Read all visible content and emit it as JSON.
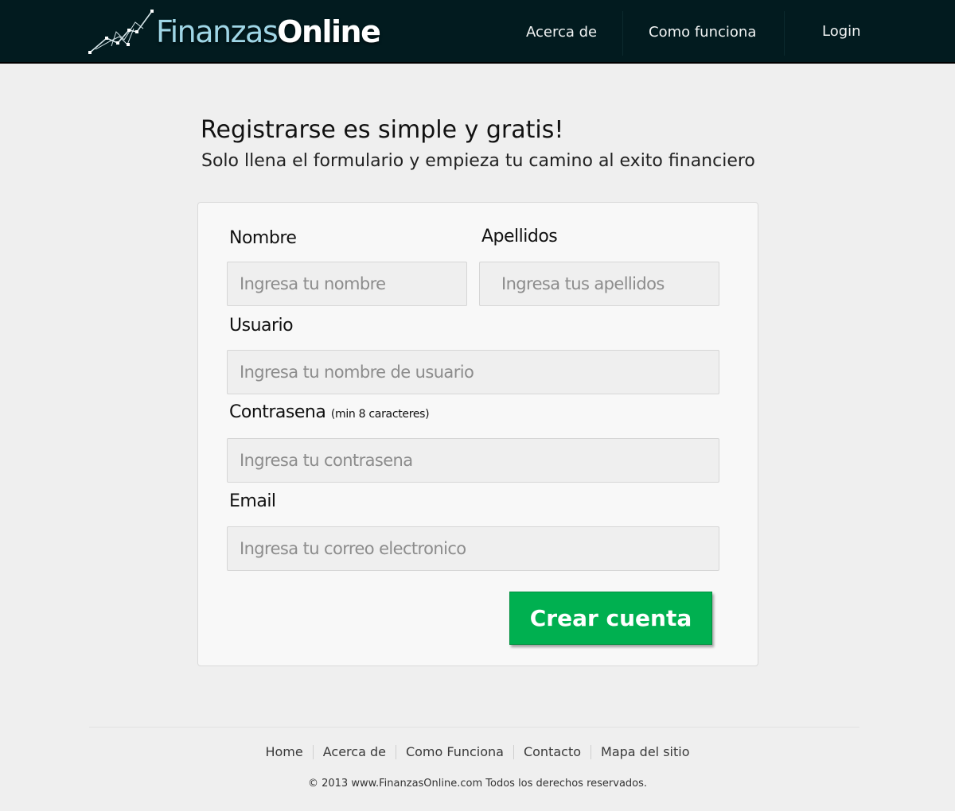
{
  "header": {
    "logo": {
      "part1": "Finanzas",
      "part2": "Online",
      "icon": "trend-chart-icon"
    },
    "nav": [
      {
        "label": "Acerca de"
      },
      {
        "label": "Como funciona"
      },
      {
        "label": "Login"
      }
    ]
  },
  "intro": {
    "title": "Registrarse es simple y gratis!",
    "subtitle": "Solo llena el formulario y empieza tu camino al exito financiero"
  },
  "form": {
    "nombre": {
      "label": "Nombre",
      "placeholder": "Ingresa tu nombre",
      "value": ""
    },
    "apellidos": {
      "label": "Apellidos",
      "placeholder": "Ingresa tus apellidos",
      "value": ""
    },
    "usuario": {
      "label": "Usuario",
      "placeholder": "Ingresa tu nombre de usuario",
      "value": ""
    },
    "contrasena": {
      "label": "Contrasena",
      "hint": "(min 8 caracteres)",
      "placeholder": "Ingresa tu contrasena",
      "value": ""
    },
    "email": {
      "label": "Email",
      "placeholder": "Ingresa tu correo electronico",
      "value": ""
    },
    "submit_label": "Crear cuenta"
  },
  "footer": {
    "links": [
      "Home",
      "Acerca de",
      "Como Funciona",
      "Contacto",
      "Mapa del sitio"
    ],
    "copyright": "© 2013 www.FinanzasOnline.com Todos los derechos reservados."
  },
  "colors": {
    "header_bg": "#021b1f",
    "logo_accent": "#9fd6e6",
    "button_green": "#00b050",
    "page_bg": "#efefef"
  }
}
